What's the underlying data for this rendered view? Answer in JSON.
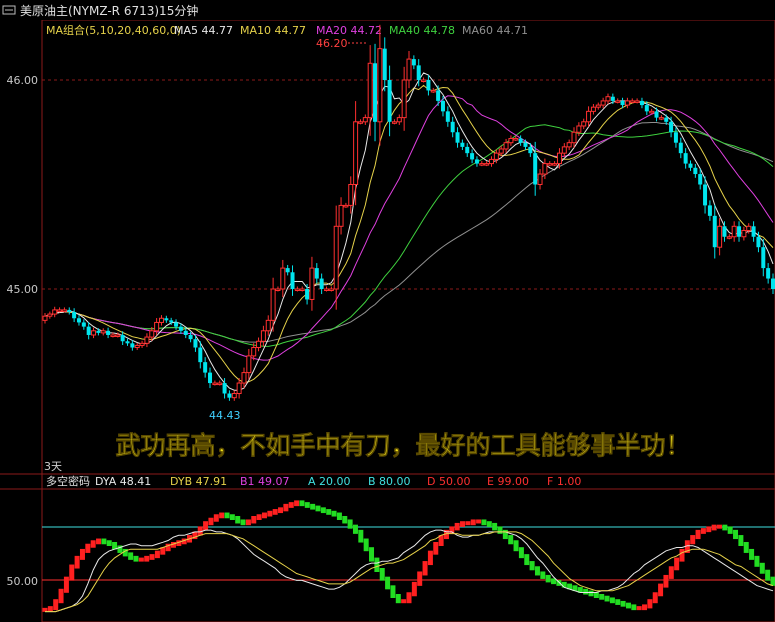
{
  "header": {
    "title": "美原油主(NYMZ-R 6713)15分钟",
    "ma_group_label": "MA组合(5,10,20,40,60,0)",
    "ma_readouts": [
      {
        "label": "MA5",
        "value": "44.77",
        "color": "#e8e8e8"
      },
      {
        "label": "MA10",
        "value": "44.77",
        "color": "#e6d24a"
      },
      {
        "label": "MA20",
        "value": "44.72",
        "color": "#e040e0"
      },
      {
        "label": "MA40",
        "value": "44.78",
        "color": "#3fd13f"
      },
      {
        "label": "MA60",
        "value": "44.71",
        "color": "#909090"
      }
    ]
  },
  "price_axis": {
    "labels": [
      "46.00",
      "45.00"
    ]
  },
  "annotations": {
    "high": "46.20",
    "low": "44.43"
  },
  "banner_text": "武功再高，不如手中有刀，最好的工具能够事半功！",
  "period_label": "3天",
  "indicator": {
    "name": "多空密码",
    "readouts": [
      {
        "label": "DYA",
        "value": "48.41",
        "color": "#e8e8e8"
      },
      {
        "label": "DYB",
        "value": "47.91",
        "color": "#e6d24a"
      },
      {
        "label": "B1",
        "value": "49.07",
        "color": "#e040e0"
      },
      {
        "label": "A",
        "value": "20.00",
        "color": "#40e0e0"
      },
      {
        "label": "B",
        "value": "80.00",
        "color": "#40e0e0"
      },
      {
        "label": "D",
        "value": "50.00",
        "color": "#ff3030"
      },
      {
        "label": "E",
        "value": "99.00",
        "color": "#ff3030"
      },
      {
        "label": "F",
        "value": "1.00",
        "color": "#ff3030"
      }
    ],
    "axis_label": "50.00"
  },
  "colors": {
    "up": "#ff3030",
    "down": "#00e5ee",
    "ind_up": "#ff2020",
    "ind_down": "#22dd22"
  },
  "chart_data": {
    "type": "candlestick",
    "ylim": [
      44.2,
      46.2
    ],
    "ind_ylim": [
      30,
      105
    ],
    "ind_levels": {
      "A": 20,
      "B": 80,
      "D": 50,
      "E": 99,
      "F": 1
    },
    "close": [
      44.87,
      44.88,
      44.9,
      44.9,
      44.9,
      44.89,
      44.86,
      44.84,
      44.82,
      44.78,
      44.8,
      44.79,
      44.8,
      44.78,
      44.78,
      44.78,
      44.75,
      44.74,
      44.72,
      44.73,
      44.74,
      44.77,
      44.8,
      44.84,
      44.86,
      44.85,
      44.84,
      44.82,
      44.8,
      44.78,
      44.76,
      44.72,
      44.65,
      44.6,
      44.55,
      44.55,
      44.55,
      44.5,
      44.48,
      44.5,
      44.55,
      44.6,
      44.68,
      44.72,
      44.75,
      44.8,
      44.85,
      45.0,
      45.0,
      45.1,
      45.08,
      45.0,
      45.0,
      45.0,
      44.95,
      45.1,
      45.05,
      45.0,
      45.0,
      45.0,
      45.3,
      45.4,
      45.4,
      45.5,
      45.8,
      45.8,
      45.82,
      46.08,
      45.8,
      46.15,
      46.0,
      45.8,
      45.8,
      45.82,
      46.0,
      46.1,
      46.07,
      46.0,
      46.0,
      45.95,
      45.95,
      45.9,
      45.85,
      45.8,
      45.75,
      45.7,
      45.68,
      45.65,
      45.62,
      45.6,
      45.6,
      45.6,
      45.62,
      45.65,
      45.67,
      45.7,
      45.72,
      45.72,
      45.7,
      45.68,
      45.65,
      45.5,
      45.55,
      45.6,
      45.6,
      45.6,
      45.65,
      45.68,
      45.7,
      45.75,
      45.78,
      45.8,
      45.85,
      45.87,
      45.88,
      45.9,
      45.92,
      45.9,
      45.9,
      45.88,
      45.9,
      45.9,
      45.9,
      45.88,
      45.85,
      45.85,
      45.82,
      45.82,
      45.8,
      45.75,
      45.7,
      45.65,
      45.6,
      45.58,
      45.55,
      45.5,
      45.4,
      45.35,
      45.2,
      45.3,
      45.25,
      45.25,
      45.3,
      45.25,
      45.28,
      45.3,
      45.25,
      45.2,
      45.1,
      45.05,
      45.0
    ],
    "dya": [
      36,
      36,
      36,
      37,
      38,
      39,
      41,
      45,
      52,
      60,
      66,
      69,
      71,
      72,
      73,
      74,
      75,
      75,
      74,
      74,
      74,
      75,
      76,
      77,
      79,
      80,
      80,
      81,
      82,
      82,
      83,
      83,
      82,
      82,
      81,
      80,
      78,
      75,
      72,
      69,
      67,
      65,
      63,
      61,
      58,
      56,
      55,
      54,
      54,
      53,
      52,
      51,
      50,
      49,
      49,
      50,
      52,
      55,
      58,
      61,
      63,
      64,
      64,
      65,
      65,
      66,
      67,
      70,
      72,
      74,
      77,
      80,
      82,
      83,
      83,
      82,
      82,
      80,
      79,
      79,
      80,
      80,
      81,
      82,
      82,
      82,
      82,
      81,
      80,
      78,
      75,
      71,
      67,
      64,
      60,
      56,
      53,
      50,
      49,
      48,
      47,
      47,
      47,
      47,
      48,
      48,
      49,
      50,
      52,
      55,
      58,
      60,
      63,
      65,
      67,
      69,
      71,
      72,
      73,
      73,
      74,
      74,
      73,
      71,
      69,
      67,
      65,
      63,
      61,
      59,
      57,
      55,
      53,
      51,
      50,
      49,
      48
    ],
    "dyb": [
      36,
      36,
      36,
      37,
      38,
      39,
      40,
      42,
      45,
      50,
      55,
      60,
      64,
      67,
      69,
      71,
      72,
      72,
      72,
      72,
      72,
      72,
      73,
      74,
      75,
      76,
      77,
      78,
      79,
      80,
      81,
      81,
      81,
      81,
      81,
      80,
      79,
      78,
      76,
      74,
      72,
      70,
      68,
      66,
      64,
      62,
      60,
      58,
      57,
      56,
      55,
      54,
      53,
      52,
      52,
      52,
      52,
      53,
      55,
      57,
      59,
      61,
      62,
      63,
      64,
      64,
      65,
      66,
      68,
      70,
      72,
      74,
      77,
      78,
      80,
      81,
      81,
      81,
      80,
      80,
      80,
      80,
      81,
      81,
      82,
      82,
      82,
      82,
      82,
      81,
      79,
      77,
      74,
      71,
      68,
      64,
      61,
      58,
      55,
      53,
      51,
      50,
      49,
      48,
      48,
      48,
      48,
      49,
      50,
      51,
      53,
      55,
      57,
      59,
      61,
      63,
      65,
      67,
      68,
      70,
      71,
      72,
      72,
      72,
      71,
      70,
      69,
      67,
      65,
      63,
      62,
      60,
      58,
      56,
      54,
      52,
      51
    ],
    "b1": [
      37,
      38,
      42,
      48,
      55,
      62,
      67,
      71,
      74,
      76,
      77,
      76,
      75,
      73,
      71,
      69,
      67,
      66,
      66,
      67,
      68,
      70,
      72,
      74,
      75,
      76,
      77,
      79,
      81,
      84,
      87,
      89,
      91,
      92,
      91,
      90,
      88,
      87,
      88,
      90,
      91,
      92,
      93,
      94,
      95,
      97,
      98,
      99,
      98,
      97,
      96,
      95,
      94,
      93,
      92,
      90,
      88,
      85,
      82,
      77,
      72,
      66,
      60,
      55,
      50,
      45,
      42,
      42,
      46,
      52,
      58,
      64,
      70,
      75,
      79,
      82,
      84,
      86,
      87,
      87,
      88,
      88,
      87,
      86,
      84,
      82,
      79,
      76,
      72,
      68,
      64,
      61,
      58,
      56,
      54,
      53,
      52,
      51,
      50,
      49,
      48,
      47,
      46,
      45,
      44,
      43,
      42,
      41,
      40,
      39,
      38,
      38,
      39,
      42,
      46,
      51,
      56,
      61,
      66,
      71,
      76,
      79,
      82,
      83,
      84,
      85,
      85,
      84,
      82,
      79,
      75,
      71,
      67,
      63,
      59,
      55,
      52
    ]
  }
}
